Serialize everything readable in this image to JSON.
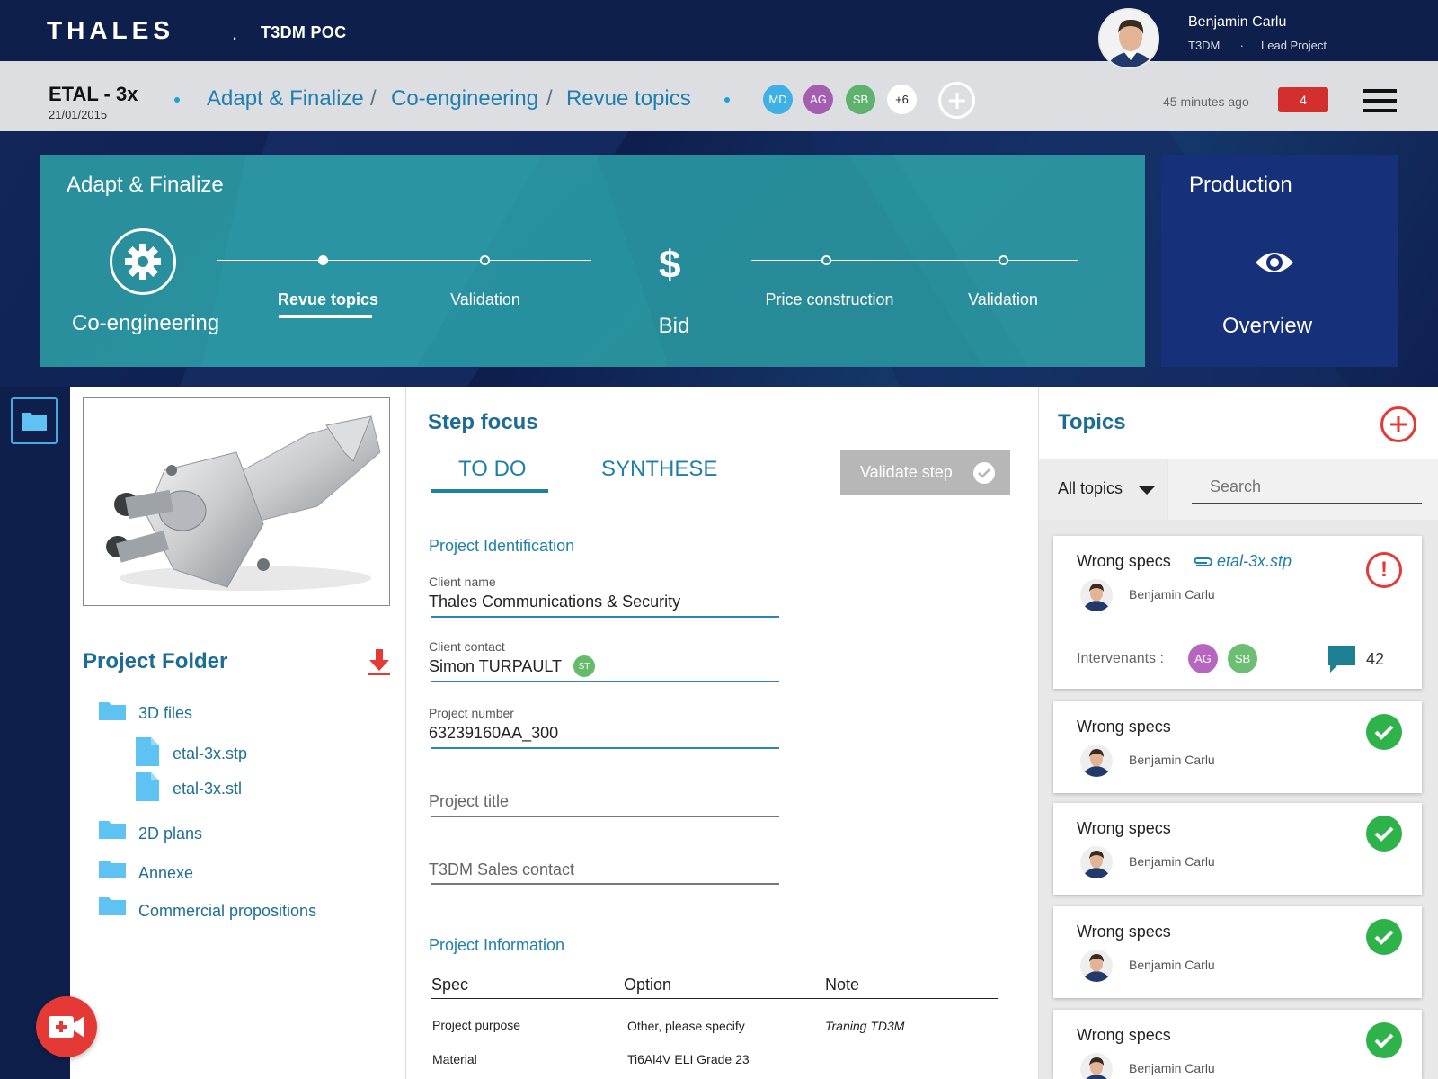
{
  "header": {
    "brand": "THALES",
    "dot": ".",
    "project_name": "T3DM POC",
    "user": {
      "name": "Benjamin Carlu",
      "org": "T3DM",
      "sep": ".",
      "role": "Lead Project"
    }
  },
  "breadcrumb": {
    "project_title": "ETAL - 3x",
    "date": "21/01/2015",
    "items": [
      "Adapt & Finalize",
      "Co-engineering",
      "Revue topics"
    ],
    "separator": "/",
    "members": [
      {
        "initials": "MD",
        "color": "#3fb0e5"
      },
      {
        "initials": "AG",
        "color": "#a45eb0"
      },
      {
        "initials": "SB",
        "color": "#5eb26d"
      }
    ],
    "more_members": "+6",
    "last_update": "45 minutes ago",
    "notifications": "4"
  },
  "stage": {
    "title": "Adapt & Finalize",
    "phase1": "Co-engineering",
    "step1": "Revue topics",
    "step2": "Validation",
    "phase2_symbol": "$",
    "phase2": "Bid",
    "step3": "Price construction",
    "step4": "Validation"
  },
  "production": {
    "title": "Production",
    "overview": "Overview"
  },
  "project_folder": {
    "title": "Project Folder",
    "folders": [
      "3D files",
      "2D plans",
      "Annexe",
      "Commercial propositions"
    ],
    "files_3d": [
      "etal-3x.stp",
      "etal-3x.stl"
    ]
  },
  "step_focus": {
    "title": "Step focus",
    "tabs": [
      "TO DO",
      "SYNTHESE"
    ],
    "validate_label": "Validate step",
    "section1": "Project Identification",
    "fields": {
      "client_name": {
        "label": "Client name",
        "value": "Thales Communications & Security"
      },
      "client_contact": {
        "label": "Client contact",
        "value": "Simon TURPAULT",
        "chip": "ST"
      },
      "project_number": {
        "label": "Project number",
        "value": "63239160AA_300"
      },
      "project_title": {
        "placeholder": "Project title"
      },
      "sales_contact": {
        "placeholder": "T3DM Sales contact"
      }
    },
    "section2": "Project Information",
    "table": {
      "headers": [
        "Spec",
        "Option",
        "Note"
      ],
      "rows": [
        [
          "Project purpose",
          "Other, please specify",
          "Traning TD3M"
        ],
        [
          "Material",
          "Ti6Al4V ELI Grade 23",
          ""
        ]
      ]
    }
  },
  "topics": {
    "title": "Topics",
    "filter": "All topics",
    "search_placeholder": "Search",
    "intervenants_label": "Intervenants :",
    "cards": [
      {
        "title": "Wrong specs",
        "author": "Benjamin Carlu",
        "attachment": "etal-3x.stp",
        "status": "alert",
        "intervenants": [
          {
            "initials": "AG",
            "color": "#b766bf"
          },
          {
            "initials": "SB",
            "color": "#6cbf72"
          }
        ],
        "comments": "42"
      },
      {
        "title": "Wrong specs",
        "author": "Benjamin Carlu",
        "status": "ok"
      },
      {
        "title": "Wrong specs",
        "author": "Benjamin Carlu",
        "status": "ok"
      },
      {
        "title": "Wrong specs",
        "author": "Benjamin Carlu",
        "status": "ok"
      },
      {
        "title": "Wrong specs",
        "author": "Benjamin Carlu",
        "status": "ok"
      }
    ]
  },
  "icons": {
    "folder": "folder-icon",
    "file": "file-icon",
    "gear": "gear-icon",
    "eye": "eye-icon",
    "download": "download-icon",
    "video": "video-add-icon",
    "check": "check-icon",
    "alert": "alert-icon",
    "attach": "paperclip-icon",
    "comment": "comment-icon",
    "menu": "menu-icon"
  },
  "colors": {
    "accent": "#1f7fa8",
    "stage": "#2a8f9d",
    "production": "#16307a",
    "alert": "#e53935",
    "ok": "#2eb24a",
    "navy": "#0f1f4b"
  }
}
